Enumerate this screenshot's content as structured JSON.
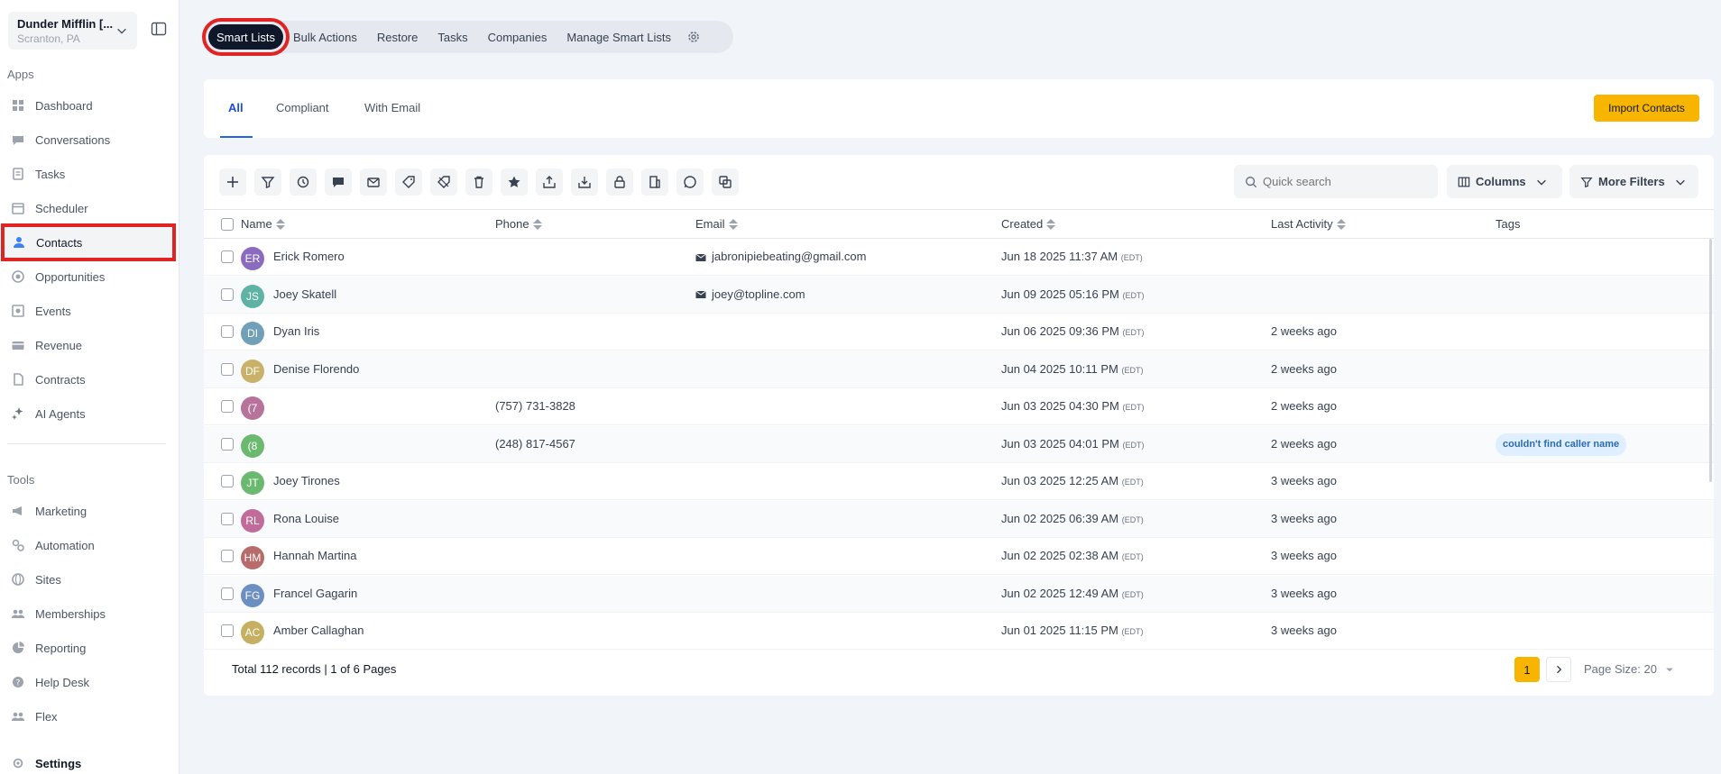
{
  "sidebar": {
    "org_name": "Dunder Mifflin [...",
    "org_location": "Scranton, PA",
    "apps_label": "Apps",
    "tools_label": "Tools",
    "apps": [
      {
        "label": "Dashboard",
        "icon": "dashboard-icon"
      },
      {
        "label": "Conversations",
        "icon": "chat-icon"
      },
      {
        "label": "Tasks",
        "icon": "task-icon"
      },
      {
        "label": "Scheduler",
        "icon": "calendar-icon"
      },
      {
        "label": "Contacts",
        "icon": "user-icon"
      },
      {
        "label": "Opportunities",
        "icon": "target-icon"
      },
      {
        "label": "Events",
        "icon": "event-icon"
      },
      {
        "label": "Revenue",
        "icon": "card-icon"
      },
      {
        "label": "Contracts",
        "icon": "document-icon"
      },
      {
        "label": "AI Agents",
        "icon": "sparkle-icon"
      }
    ],
    "tools": [
      {
        "label": "Marketing",
        "icon": "megaphone-icon"
      },
      {
        "label": "Automation",
        "icon": "gears-icon"
      },
      {
        "label": "Sites",
        "icon": "globe-icon"
      },
      {
        "label": "Memberships",
        "icon": "members-icon"
      },
      {
        "label": "Reporting",
        "icon": "pie-icon"
      },
      {
        "label": "Help Desk",
        "icon": "help-icon"
      },
      {
        "label": "Flex",
        "icon": "flex-icon"
      }
    ],
    "settings_label": "Settings"
  },
  "top_tabs": [
    "Smart Lists",
    "Bulk Actions",
    "Restore",
    "Tasks",
    "Companies",
    "Manage Smart Lists"
  ],
  "sub_tabs": [
    "All",
    "Compliant",
    "With Email"
  ],
  "import_button": "Import Contacts",
  "toolbar": {
    "icons": [
      "add-icon",
      "filter-icon",
      "pipeline-icon",
      "sms-icon",
      "email-icon",
      "add-tag-icon",
      "remove-tag-icon",
      "delete-icon",
      "star-icon",
      "export-icon",
      "import-icon",
      "lock-icon",
      "company-icon",
      "whatsapp-icon",
      "merge-icon"
    ],
    "search_placeholder": "Quick search",
    "columns_label": "Columns",
    "more_filters_label": "More Filters"
  },
  "table": {
    "headers": [
      "Name",
      "Phone",
      "Email",
      "Created",
      "Last Activity",
      "Tags"
    ],
    "rows": [
      {
        "initials": "ER",
        "color": "#8b6bbf",
        "name": "Erick Romero",
        "phone": "",
        "email": "jabronipiebeating@gmail.com",
        "created": "Jun 18 2025 11:37 AM",
        "tz": "(EDT)",
        "activity": "",
        "tag": ""
      },
      {
        "initials": "JS",
        "color": "#5fb3a5",
        "name": "Joey Skatell",
        "phone": "",
        "email": "joey@topline.com",
        "created": "Jun 09 2025 05:16 PM",
        "tz": "(EDT)",
        "activity": "",
        "tag": ""
      },
      {
        "initials": "DI",
        "color": "#6fa0b8",
        "name": "Dyan Iris",
        "phone": "",
        "email": "",
        "created": "Jun 06 2025 09:36 PM",
        "tz": "(EDT)",
        "activity": "2 weeks ago",
        "tag": ""
      },
      {
        "initials": "DF",
        "color": "#c9b16a",
        "name": "Denise Florendo",
        "phone": "",
        "email": "",
        "created": "Jun 04 2025 10:11 PM",
        "tz": "(EDT)",
        "activity": "2 weeks ago",
        "tag": ""
      },
      {
        "initials": "(7",
        "color": "#b8739a",
        "name": "",
        "phone": "(757) 731-3828",
        "email": "",
        "created": "Jun 03 2025 04:30 PM",
        "tz": "(EDT)",
        "activity": "2 weeks ago",
        "tag": ""
      },
      {
        "initials": "(8",
        "color": "#6bb86f",
        "name": "",
        "phone": "(248) 817-4567",
        "email": "",
        "created": "Jun 03 2025 04:01 PM",
        "tz": "(EDT)",
        "activity": "2 weeks ago",
        "tag": "couldn't find caller name"
      },
      {
        "initials": "JT",
        "color": "#6bb86f",
        "name": "Joey Tirones",
        "phone": "",
        "email": "",
        "created": "Jun 03 2025 12:25 AM",
        "tz": "(EDT)",
        "activity": "3 weeks ago",
        "tag": ""
      },
      {
        "initials": "RL",
        "color": "#c06b9a",
        "name": "Rona Louise",
        "phone": "",
        "email": "",
        "created": "Jun 02 2025 06:39 AM",
        "tz": "(EDT)",
        "activity": "3 weeks ago",
        "tag": ""
      },
      {
        "initials": "HM",
        "color": "#b86b6b",
        "name": "Hannah Martina",
        "phone": "",
        "email": "",
        "created": "Jun 02 2025 02:38 AM",
        "tz": "(EDT)",
        "activity": "3 weeks ago",
        "tag": ""
      },
      {
        "initials": "FG",
        "color": "#6b8fc0",
        "name": "Francel Gagarin",
        "phone": "",
        "email": "",
        "created": "Jun 02 2025 12:49 AM",
        "tz": "(EDT)",
        "activity": "3 weeks ago",
        "tag": ""
      },
      {
        "initials": "AC",
        "color": "#c4b060",
        "name": "Amber Callaghan",
        "phone": "",
        "email": "",
        "created": "Jun 01 2025 11:15 PM",
        "tz": "(EDT)",
        "activity": "3 weeks ago",
        "tag": ""
      }
    ]
  },
  "footer": {
    "total": "Total 112 records | 1 of 6 Pages",
    "current_page": "1",
    "page_size": "Page Size: 20"
  }
}
